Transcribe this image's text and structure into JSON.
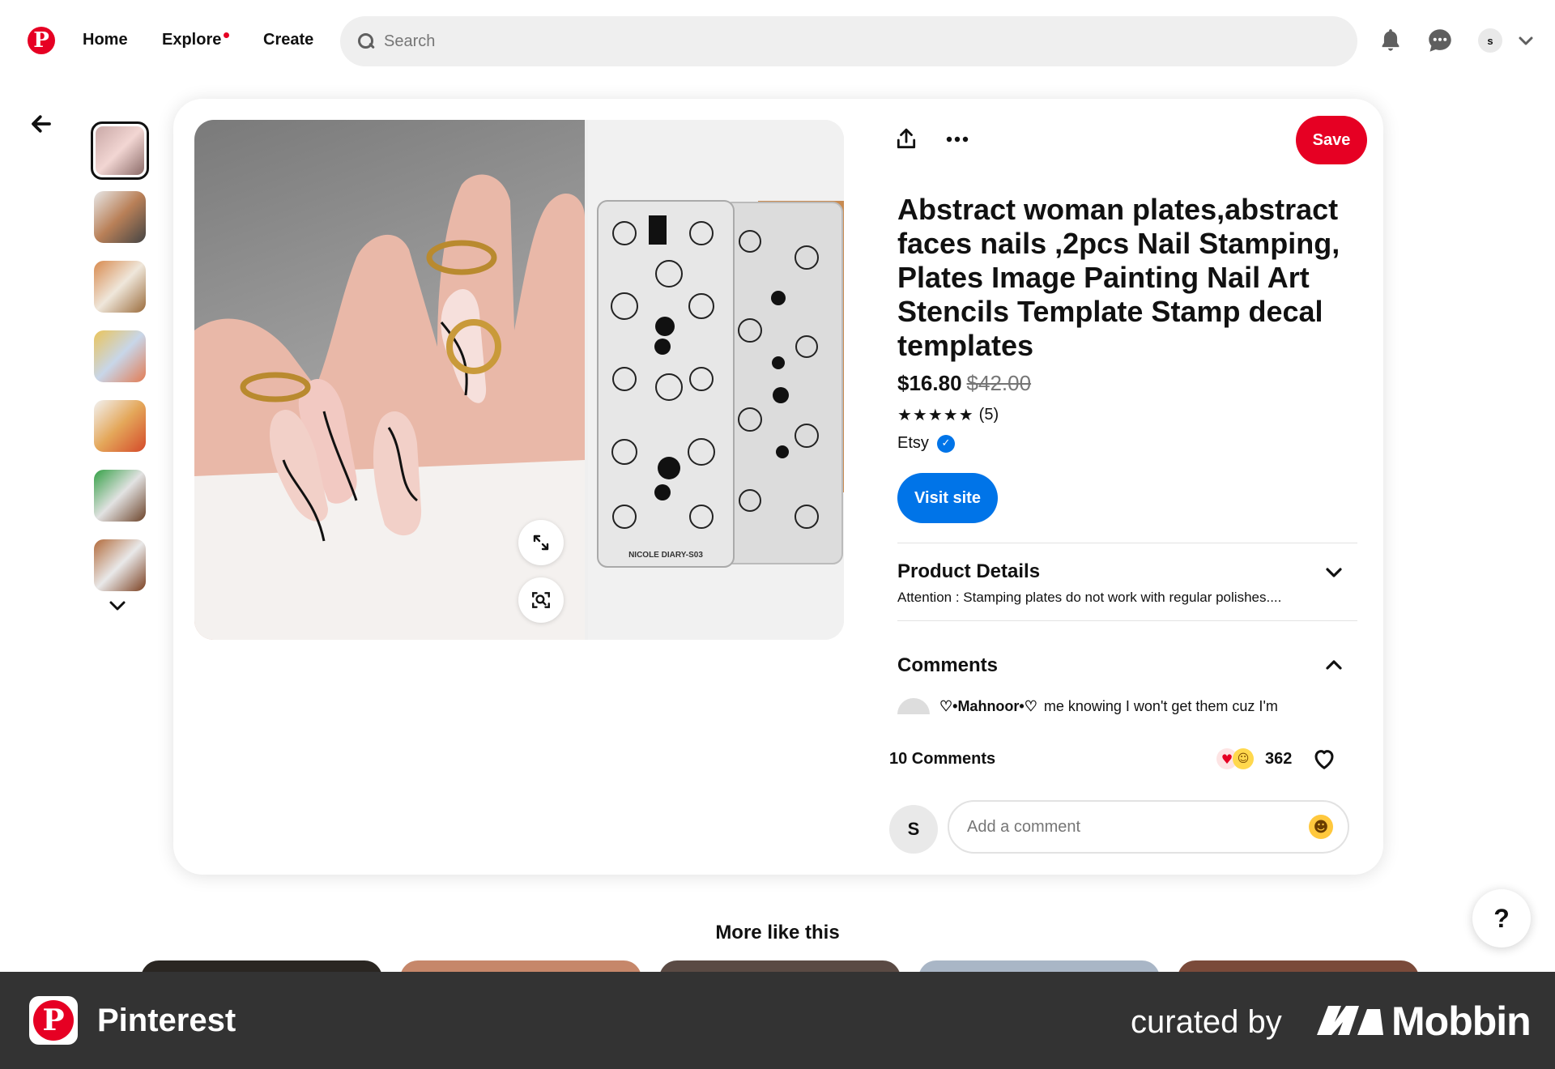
{
  "header": {
    "nav": {
      "home": "Home",
      "explore": "Explore",
      "create": "Create"
    },
    "search_placeholder": "Search",
    "user_initial": "s",
    "icons": [
      "pinterest-logo-icon",
      "search-icon",
      "bell-icon",
      "chat-icon",
      "chevron-down-icon"
    ]
  },
  "thumbnails": [
    {
      "colors": [
        "#c9a8a6",
        "#f2d6d3",
        "#8b6b68"
      ]
    },
    {
      "colors": [
        "#e8e8e8",
        "#b98058",
        "#444"
      ]
    },
    {
      "colors": [
        "#d88a4e",
        "#efe7db",
        "#9a6b3b"
      ]
    },
    {
      "colors": [
        "#eac45a",
        "#c8d6e9",
        "#e27b53"
      ]
    },
    {
      "colors": [
        "#f2f2f2",
        "#e4a75a",
        "#d44a2a"
      ]
    },
    {
      "colors": [
        "#34a046",
        "#e2e2e2",
        "#6b4228"
      ]
    },
    {
      "colors": [
        "#b26a3b",
        "#e9e9e9",
        "#7b3f20"
      ]
    }
  ],
  "pin": {
    "save_label": "Save",
    "title": "Abstract woman plates,abstract faces nails ,2pcs Nail Stamping, Plates Image Painting Nail Art Stencils Template Stamp decal templates",
    "price": "$16.80",
    "old_price": "$42.00",
    "stars": "★★★★★",
    "rating_value": 4.5,
    "rating_count": "(5)",
    "store": "Etsy",
    "visit_label": "Visit site",
    "plate_label": "NICOLE DIARY-S03"
  },
  "product_details": {
    "title": "Product Details",
    "text": "Attention : Stamping plates do not work with regular polishes...."
  },
  "comments": {
    "title": "Comments",
    "preview_author": "♡•Mahnoor•♡",
    "preview_text": "me knowing I won't get them cuz I'm",
    "count_label": "10 Comments",
    "reaction_count": "362",
    "user_initial": "S",
    "input_placeholder": "Add a comment"
  },
  "more_like_this": "More like this",
  "help_label": "?",
  "footer": {
    "app_name": "Pinterest",
    "curated_by": "curated by",
    "brand": "Mobbin"
  },
  "colors": {
    "brand_red": "#e60023",
    "link_blue": "#0074e8",
    "footer_bg": "#333333"
  }
}
